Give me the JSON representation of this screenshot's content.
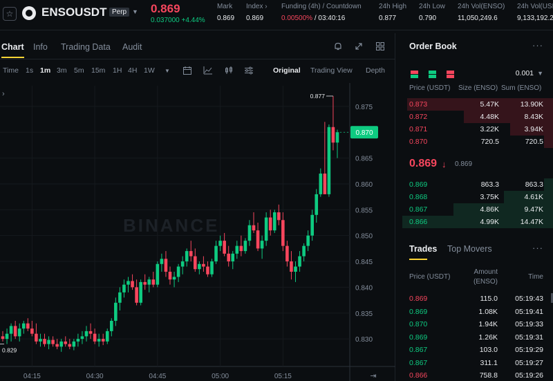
{
  "header": {
    "symbol": "ENSOUSDT",
    "contract_type": "Perp",
    "last_price": "0.869",
    "change_abs": "0.037000",
    "change_pct": "+4.44%",
    "stats": [
      {
        "label": "Mark",
        "value": "0.869"
      },
      {
        "label": "Index ›",
        "value": "0.869"
      },
      {
        "label": "Funding (4h) / Countdown",
        "value_rate": "0.00500%",
        "value_countdown": " / 03:40:16"
      },
      {
        "label": "24h High",
        "value": "0.877"
      },
      {
        "label": "24h Low",
        "value": "0.790"
      },
      {
        "label": "24h Vol(ENSO)",
        "value": "11,050,249.6"
      },
      {
        "label": "24h Vol(USD",
        "value": "9,133,192.2"
      }
    ]
  },
  "chart_panel": {
    "tabs": [
      "Chart",
      "Info",
      "Trading Data",
      "Audit"
    ],
    "active_tab": "Chart",
    "timeframes": [
      "Time",
      "1s",
      "1m",
      "3m",
      "5m",
      "15m",
      "1H",
      "4H",
      "1W"
    ],
    "active_timeframe": "1m",
    "views": [
      "Original",
      "Trading View",
      "Depth"
    ],
    "active_view": "Original",
    "watermark": "BINANCE"
  },
  "chart_data": {
    "type": "candlestick",
    "title": "",
    "current_price_label": "0.870",
    "high_label": "0.877",
    "low_label": "0.829",
    "ylim": [
      0.826,
      0.879
    ],
    "y_ticks": [
      "0.875",
      "0.870",
      "0.865",
      "0.860",
      "0.855",
      "0.850",
      "0.845",
      "0.840",
      "0.835",
      "0.830"
    ],
    "x_ticks": [
      {
        "label": "04:15",
        "index": 7
      },
      {
        "label": "04:30",
        "index": 22
      },
      {
        "label": "04:45",
        "index": 37
      },
      {
        "label": "05:00",
        "index": 52
      },
      {
        "label": "05:15",
        "index": 67
      }
    ],
    "colors": {
      "up": "#0ecb81",
      "down": "#f6465d"
    },
    "candles": [
      {
        "o": 0.8305,
        "h": 0.8315,
        "l": 0.8295,
        "c": 0.83
      },
      {
        "o": 0.83,
        "h": 0.832,
        "l": 0.829,
        "c": 0.831
      },
      {
        "o": 0.831,
        "h": 0.833,
        "l": 0.8295,
        "c": 0.8325
      },
      {
        "o": 0.8325,
        "h": 0.8335,
        "l": 0.83,
        "c": 0.8305
      },
      {
        "o": 0.8305,
        "h": 0.833,
        "l": 0.8295,
        "c": 0.832
      },
      {
        "o": 0.832,
        "h": 0.8335,
        "l": 0.831,
        "c": 0.833
      },
      {
        "o": 0.833,
        "h": 0.834,
        "l": 0.8315,
        "c": 0.832
      },
      {
        "o": 0.832,
        "h": 0.8335,
        "l": 0.8305,
        "c": 0.831
      },
      {
        "o": 0.831,
        "h": 0.833,
        "l": 0.829,
        "c": 0.8295
      },
      {
        "o": 0.8295,
        "h": 0.831,
        "l": 0.8285,
        "c": 0.83
      },
      {
        "o": 0.83,
        "h": 0.831,
        "l": 0.8285,
        "c": 0.829
      },
      {
        "o": 0.829,
        "h": 0.8305,
        "l": 0.828,
        "c": 0.8298
      },
      {
        "o": 0.8298,
        "h": 0.8305,
        "l": 0.8285,
        "c": 0.829
      },
      {
        "o": 0.829,
        "h": 0.83,
        "l": 0.828,
        "c": 0.8285
      },
      {
        "o": 0.8285,
        "h": 0.83,
        "l": 0.8275,
        "c": 0.8295
      },
      {
        "o": 0.8295,
        "h": 0.8305,
        "l": 0.8285,
        "c": 0.829
      },
      {
        "o": 0.829,
        "h": 0.83,
        "l": 0.828,
        "c": 0.8285
      },
      {
        "o": 0.8285,
        "h": 0.83,
        "l": 0.8278,
        "c": 0.8295
      },
      {
        "o": 0.8295,
        "h": 0.831,
        "l": 0.8285,
        "c": 0.83
      },
      {
        "o": 0.83,
        "h": 0.8315,
        "l": 0.829,
        "c": 0.8305
      },
      {
        "o": 0.8305,
        "h": 0.8325,
        "l": 0.8295,
        "c": 0.8315
      },
      {
        "o": 0.8315,
        "h": 0.833,
        "l": 0.83,
        "c": 0.831
      },
      {
        "o": 0.831,
        "h": 0.832,
        "l": 0.829,
        "c": 0.8295
      },
      {
        "o": 0.8295,
        "h": 0.831,
        "l": 0.8285,
        "c": 0.83
      },
      {
        "o": 0.83,
        "h": 0.831,
        "l": 0.8288,
        "c": 0.8295
      },
      {
        "o": 0.8295,
        "h": 0.832,
        "l": 0.829,
        "c": 0.8315
      },
      {
        "o": 0.8315,
        "h": 0.834,
        "l": 0.8305,
        "c": 0.8335
      },
      {
        "o": 0.8335,
        "h": 0.838,
        "l": 0.8325,
        "c": 0.837
      },
      {
        "o": 0.837,
        "h": 0.84,
        "l": 0.8355,
        "c": 0.839
      },
      {
        "o": 0.839,
        "h": 0.8415,
        "l": 0.838,
        "c": 0.8405
      },
      {
        "o": 0.8405,
        "h": 0.842,
        "l": 0.839,
        "c": 0.8412
      },
      {
        "o": 0.8412,
        "h": 0.8425,
        "l": 0.8395,
        "c": 0.84
      },
      {
        "o": 0.84,
        "h": 0.8415,
        "l": 0.8365,
        "c": 0.837
      },
      {
        "o": 0.837,
        "h": 0.8415,
        "l": 0.8365,
        "c": 0.841
      },
      {
        "o": 0.841,
        "h": 0.8425,
        "l": 0.8395,
        "c": 0.8405
      },
      {
        "o": 0.8405,
        "h": 0.842,
        "l": 0.839,
        "c": 0.8415
      },
      {
        "o": 0.8415,
        "h": 0.843,
        "l": 0.84,
        "c": 0.8405
      },
      {
        "o": 0.8405,
        "h": 0.845,
        "l": 0.84,
        "c": 0.8445
      },
      {
        "o": 0.8445,
        "h": 0.8465,
        "l": 0.843,
        "c": 0.8455
      },
      {
        "o": 0.8455,
        "h": 0.847,
        "l": 0.842,
        "c": 0.843
      },
      {
        "o": 0.843,
        "h": 0.844,
        "l": 0.8405,
        "c": 0.8415
      },
      {
        "o": 0.8415,
        "h": 0.843,
        "l": 0.84,
        "c": 0.842
      },
      {
        "o": 0.842,
        "h": 0.8445,
        "l": 0.841,
        "c": 0.844
      },
      {
        "o": 0.844,
        "h": 0.846,
        "l": 0.8425,
        "c": 0.845
      },
      {
        "o": 0.845,
        "h": 0.8475,
        "l": 0.844,
        "c": 0.847
      },
      {
        "o": 0.847,
        "h": 0.849,
        "l": 0.845,
        "c": 0.846
      },
      {
        "o": 0.846,
        "h": 0.8475,
        "l": 0.843,
        "c": 0.8435
      },
      {
        "o": 0.8435,
        "h": 0.845,
        "l": 0.8425,
        "c": 0.8445
      },
      {
        "o": 0.8445,
        "h": 0.846,
        "l": 0.843,
        "c": 0.844
      },
      {
        "o": 0.844,
        "h": 0.845,
        "l": 0.842,
        "c": 0.8425
      },
      {
        "o": 0.8425,
        "h": 0.8455,
        "l": 0.842,
        "c": 0.845
      },
      {
        "o": 0.845,
        "h": 0.849,
        "l": 0.8445,
        "c": 0.848
      },
      {
        "o": 0.848,
        "h": 0.85,
        "l": 0.847,
        "c": 0.849
      },
      {
        "o": 0.849,
        "h": 0.8505,
        "l": 0.846,
        "c": 0.8465
      },
      {
        "o": 0.8465,
        "h": 0.848,
        "l": 0.844,
        "c": 0.845
      },
      {
        "o": 0.845,
        "h": 0.847,
        "l": 0.8435,
        "c": 0.8465
      },
      {
        "o": 0.8465,
        "h": 0.849,
        "l": 0.8455,
        "c": 0.848
      },
      {
        "o": 0.848,
        "h": 0.85,
        "l": 0.846,
        "c": 0.847
      },
      {
        "o": 0.847,
        "h": 0.8495,
        "l": 0.8465,
        "c": 0.849
      },
      {
        "o": 0.849,
        "h": 0.853,
        "l": 0.848,
        "c": 0.852
      },
      {
        "o": 0.852,
        "h": 0.8545,
        "l": 0.8505,
        "c": 0.851
      },
      {
        "o": 0.851,
        "h": 0.8525,
        "l": 0.847,
        "c": 0.8475
      },
      {
        "o": 0.8475,
        "h": 0.85,
        "l": 0.8455,
        "c": 0.849
      },
      {
        "o": 0.849,
        "h": 0.8545,
        "l": 0.848,
        "c": 0.8535
      },
      {
        "o": 0.8535,
        "h": 0.855,
        "l": 0.85,
        "c": 0.851
      },
      {
        "o": 0.851,
        "h": 0.855,
        "l": 0.8505,
        "c": 0.8545
      },
      {
        "o": 0.8545,
        "h": 0.856,
        "l": 0.852,
        "c": 0.853
      },
      {
        "o": 0.853,
        "h": 0.8545,
        "l": 0.847,
        "c": 0.848
      },
      {
        "o": 0.848,
        "h": 0.849,
        "l": 0.844,
        "c": 0.845
      },
      {
        "o": 0.845,
        "h": 0.847,
        "l": 0.8415,
        "c": 0.843
      },
      {
        "o": 0.843,
        "h": 0.845,
        "l": 0.841,
        "c": 0.844
      },
      {
        "o": 0.844,
        "h": 0.847,
        "l": 0.843,
        "c": 0.846
      },
      {
        "o": 0.846,
        "h": 0.8485,
        "l": 0.845,
        "c": 0.848
      },
      {
        "o": 0.848,
        "h": 0.851,
        "l": 0.847,
        "c": 0.85
      },
      {
        "o": 0.85,
        "h": 0.855,
        "l": 0.849,
        "c": 0.854
      },
      {
        "o": 0.854,
        "h": 0.859,
        "l": 0.8525,
        "c": 0.858
      },
      {
        "o": 0.858,
        "h": 0.863,
        "l": 0.8575,
        "c": 0.862
      },
      {
        "o": 0.862,
        "h": 0.872,
        "l": 0.858,
        "c": 0.858
      },
      {
        "o": 0.858,
        "h": 0.8715,
        "l": 0.8575,
        "c": 0.871
      },
      {
        "o": 0.871,
        "h": 0.877,
        "l": 0.8665,
        "c": 0.868
      },
      {
        "o": 0.868,
        "h": 0.8705,
        "l": 0.865,
        "c": 0.87
      }
    ]
  },
  "order_book": {
    "title": "Order Book",
    "tick_size": "0.001",
    "headers": [
      "Price (USDT)",
      "Size (ENSO)",
      "Sum (ENSO)"
    ],
    "asks": [
      {
        "price": "0.873",
        "size": "5.47K",
        "sum": "13.90K",
        "depth": 0.95
      },
      {
        "price": "0.872",
        "size": "4.48K",
        "sum": "8.43K",
        "depth": 0.58
      },
      {
        "price": "0.871",
        "size": "3.22K",
        "sum": "3.94K",
        "depth": 0.28
      },
      {
        "price": "0.870",
        "size": "720.5",
        "sum": "720.5",
        "depth": 0.06
      }
    ],
    "mid_price": "0.869",
    "mid_mark": "0.869",
    "bids": [
      {
        "price": "0.869",
        "size": "863.3",
        "sum": "863.3",
        "depth": 0.06
      },
      {
        "price": "0.868",
        "size": "3.75K",
        "sum": "4.61K",
        "depth": 0.32
      },
      {
        "price": "0.867",
        "size": "4.86K",
        "sum": "9.47K",
        "depth": 0.65
      },
      {
        "price": "0.866",
        "size": "4.99K",
        "sum": "14.47K",
        "depth": 0.98
      }
    ]
  },
  "trades": {
    "tabs": [
      "Trades",
      "Top Movers"
    ],
    "active_tab": "Trades",
    "headers": {
      "price": "Price (USDT)",
      "amount_line1": "Amount",
      "amount_line2": "(ENSO)",
      "time": "Time"
    },
    "rows": [
      {
        "price": "0.869",
        "amount": "115.0",
        "time": "05:19:43",
        "side": "sell"
      },
      {
        "price": "0.869",
        "amount": "1.08K",
        "time": "05:19:41",
        "side": "buy"
      },
      {
        "price": "0.870",
        "amount": "1.94K",
        "time": "05:19:33",
        "side": "buy"
      },
      {
        "price": "0.869",
        "amount": "1.26K",
        "time": "05:19:31",
        "side": "buy"
      },
      {
        "price": "0.867",
        "amount": "103.0",
        "time": "05:19:29",
        "side": "buy"
      },
      {
        "price": "0.867",
        "amount": "311.1",
        "time": "05:19:27",
        "side": "buy"
      },
      {
        "price": "0.866",
        "amount": "758.8",
        "time": "05:19:26",
        "side": "sell"
      }
    ]
  }
}
